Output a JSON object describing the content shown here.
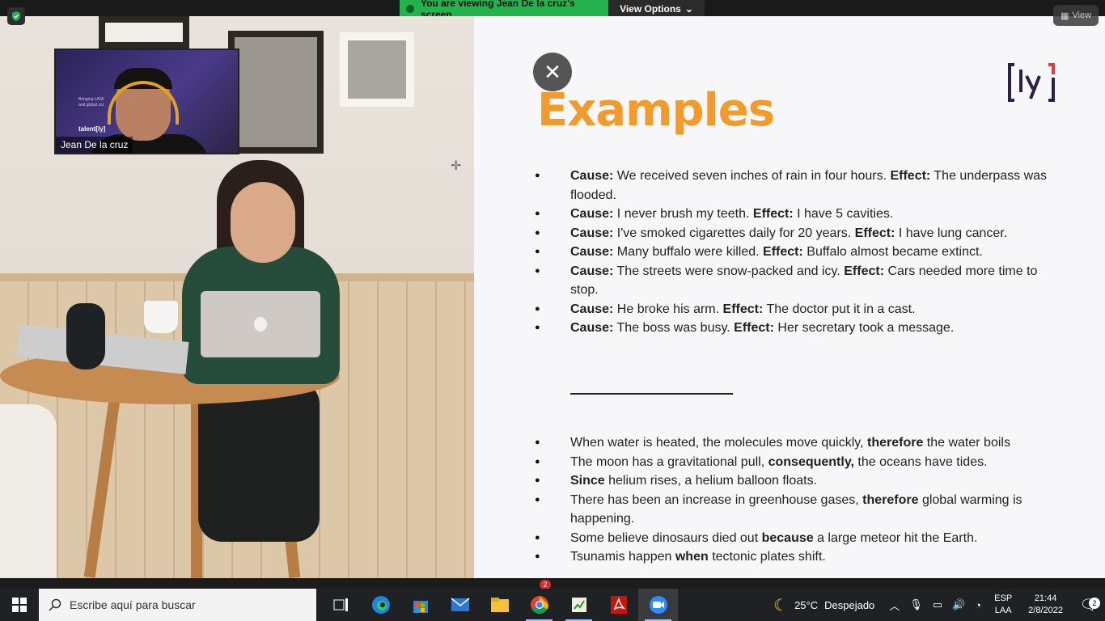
{
  "zoom": {
    "viewing_banner": "You are viewing Jean De la cruz's screen",
    "view_options_label": "View Options",
    "view_button_label": "View",
    "participant_badge": "2"
  },
  "video": {
    "participant_name": "Jean De la cruz",
    "background_text_line1": "Bringing LATA",
    "background_text_line2": "and global cor",
    "background_logo": "talent[ly]"
  },
  "slide": {
    "title": "Examples",
    "logo_text": "[ly]",
    "accent_color": "#f39a2c",
    "logo_colors": [
      "#2d2143",
      "#e03a3a"
    ],
    "cause_effect": [
      {
        "cause_label": "Cause:",
        "cause": " We received seven inches of rain in four hours. ",
        "effect_label": "Effect:",
        "effect": " The underpass was flooded."
      },
      {
        "cause_label": "Cause:",
        "cause": " I never brush my teeth. ",
        "effect_label": "Effect:",
        "effect": " I have 5 cavities."
      },
      {
        "cause_label": "Cause:",
        "cause": " I've smoked cigarettes daily for 20 years. ",
        "effect_label": "Effect:",
        "effect": " I have lung cancer."
      },
      {
        "cause_label": "Cause:",
        "cause": " Many buffalo were killed. ",
        "effect_label": "Effect:",
        "effect": " Buffalo almost became extinct."
      },
      {
        "cause_label": "Cause:",
        "cause": " The streets were snow-packed and icy. ",
        "effect_label": "Effect:",
        "effect": " Cars needed more time to stop."
      },
      {
        "cause_label": "Cause:",
        "cause": " He broke his arm. ",
        "effect_label": "Effect:",
        "effect": " The doctor put it in a cast."
      },
      {
        "cause_label": "Cause:",
        "cause": " The boss was busy. ",
        "effect_label": "Effect:",
        "effect": " Her secretary took a message."
      }
    ],
    "connectors": [
      {
        "before": "When water is heated, the molecules move quickly, ",
        "keyword": "therefore",
        "after": " the water boils"
      },
      {
        "before": "The moon has a gravitational pull, ",
        "keyword": "consequently,",
        "after": " the oceans have tides."
      },
      {
        "before": "",
        "keyword": "Since",
        "after": " helium rises, a helium balloon floats."
      },
      {
        "before": "There has been an increase in greenhouse gases, ",
        "keyword": "therefore",
        "after": " global warming is happening."
      },
      {
        "before": "Some believe dinosaurs died out ",
        "keyword": "because",
        "after": " a large meteor hit the Earth."
      },
      {
        "before": "Tsunamis happen ",
        "keyword": "when",
        "after": " tectonic plates shift."
      }
    ]
  },
  "taskbar": {
    "search_placeholder": "Escribe aquí para buscar",
    "apps": [
      "task-view-icon",
      "edge-icon",
      "store-icon",
      "mail-icon",
      "file-explorer-icon",
      "chrome-icon",
      "spreadsheet-icon",
      "acrobat-icon",
      "zoom-icon"
    ],
    "weather_temp": "25°C",
    "weather_text": "Despejado",
    "lang_line1": "ESP",
    "lang_line2": "LAA",
    "time": "21:44",
    "date": "2/8/2022",
    "notification_count": "2"
  }
}
